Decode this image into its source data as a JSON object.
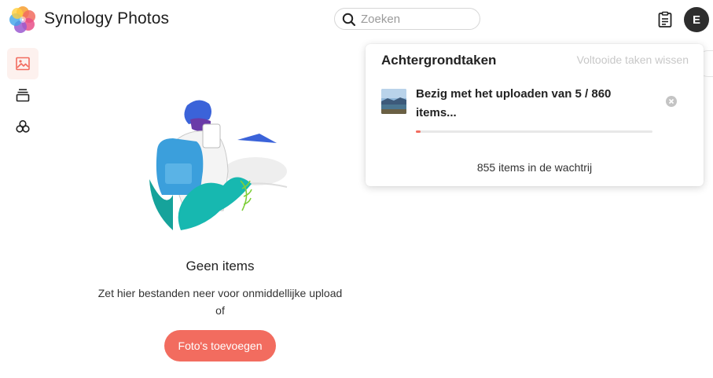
{
  "header": {
    "app_title": "Synology Photos",
    "search_placeholder": "Zoeken",
    "avatar_initial": "E",
    "logo_icon": "synology-photos-flower-logo",
    "tasks_icon": "clipboard-icon"
  },
  "sidebar": {
    "items": [
      {
        "icon": "photo-icon",
        "active": true
      },
      {
        "icon": "albums-stack-icon",
        "active": false
      },
      {
        "icon": "shared-circles-icon",
        "active": false
      }
    ]
  },
  "empty_state": {
    "title": "Geen items",
    "line1": "Zet hier bestanden neer voor onmiddellijke upload",
    "line2": "of",
    "button_label": "Foto's toevoegen"
  },
  "background_tasks": {
    "title": "Achtergrondtaken",
    "clear_label": "Voltooide taken wissen",
    "task": {
      "text": "Bezig met het uploaden van 5 / 860 items...",
      "progress": 0.006
    },
    "queue_text": "855 items in de wachtrij"
  },
  "colors": {
    "accent": "#f26c5f",
    "active_bg": "#fdf1ee",
    "avatar_bg": "#2d2d2d"
  }
}
